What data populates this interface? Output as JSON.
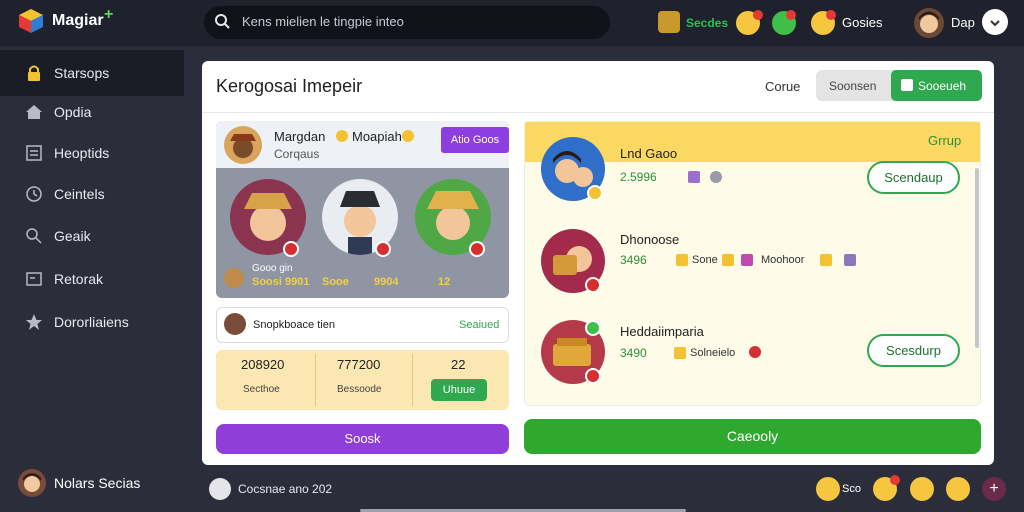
{
  "app": {
    "name": "Magiar"
  },
  "search": {
    "value": "Kens mielien le tingpie inteo"
  },
  "topbar": {
    "currency": "Secdes",
    "gossip_label": "Gosies",
    "user_name": "Dap"
  },
  "sidebar": {
    "items": [
      {
        "label": "Starsops",
        "icon": "lock-icon"
      },
      {
        "label": "Opdia",
        "icon": "star-icon"
      },
      {
        "label": "Heoptids",
        "icon": "list-icon"
      },
      {
        "label": "Ceintels",
        "icon": "clock-icon"
      },
      {
        "label": "Geaik",
        "icon": "search-icon"
      },
      {
        "label": "Retorak",
        "icon": "card-icon"
      },
      {
        "label": "Dororliaiens",
        "icon": "star-icon"
      }
    ],
    "user_name": "Nolars Secias"
  },
  "panel": {
    "title": "Kerogosai Imepeir",
    "sort_label": "Corue",
    "segment_options": [
      "Soonsen",
      "Sooeueh"
    ]
  },
  "left_card": {
    "name": "Margdan",
    "name_extra": "Moapiah",
    "subtitle": "Corqaus",
    "button_label": "Atio Goos",
    "char_label": "Gooo gin",
    "stats": [
      "Soosi 9901",
      "Sooe",
      "9904",
      "12"
    ]
  },
  "invite": {
    "text": "Snopkboace tien",
    "link": "Seaiued"
  },
  "stats": [
    {
      "value": "208920",
      "label": "Secthoe"
    },
    {
      "value": "777200",
      "label": "Bessoode"
    },
    {
      "value": "22",
      "label": "Uhuue"
    }
  ],
  "purple_button": "Soosk",
  "right_list": {
    "header_action": "Grrup",
    "items": [
      {
        "name": "Lnd Gaoo",
        "score": "2.5996",
        "extra": "",
        "extra2": "",
        "button": "Scendaup"
      },
      {
        "name": "Dhonoose",
        "score": "3496",
        "extra": "Sone",
        "extra2": "Moohoor",
        "button": ""
      },
      {
        "name": "Heddaiimparia",
        "score": "3490",
        "extra": "Solneielo",
        "extra2": "",
        "button": "Scesdurp"
      }
    ]
  },
  "green_button": "Caeooly",
  "bottom": {
    "text": "Cocsnae ano 202",
    "score": "Sco"
  },
  "colors": {
    "accent_green": "#2fa84f",
    "accent_purple": "#8f3fd8",
    "header_yellow": "#fbd861"
  }
}
